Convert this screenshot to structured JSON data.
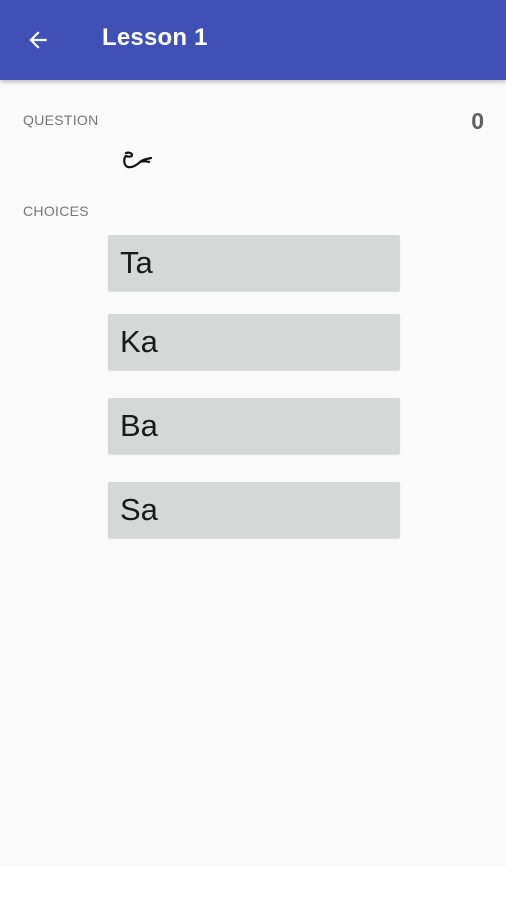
{
  "appbar": {
    "title": "Lesson 1",
    "back_icon": "arrow-left-icon",
    "color": "#3f51b5"
  },
  "question": {
    "label": "QUESTION",
    "glyph_icon": "script-character-icon",
    "score": "0"
  },
  "choices": {
    "label": "CHOICES",
    "items": [
      {
        "label": "Ta"
      },
      {
        "label": "Ka"
      },
      {
        "label": "Ba"
      },
      {
        "label": "Sa"
      }
    ]
  }
}
